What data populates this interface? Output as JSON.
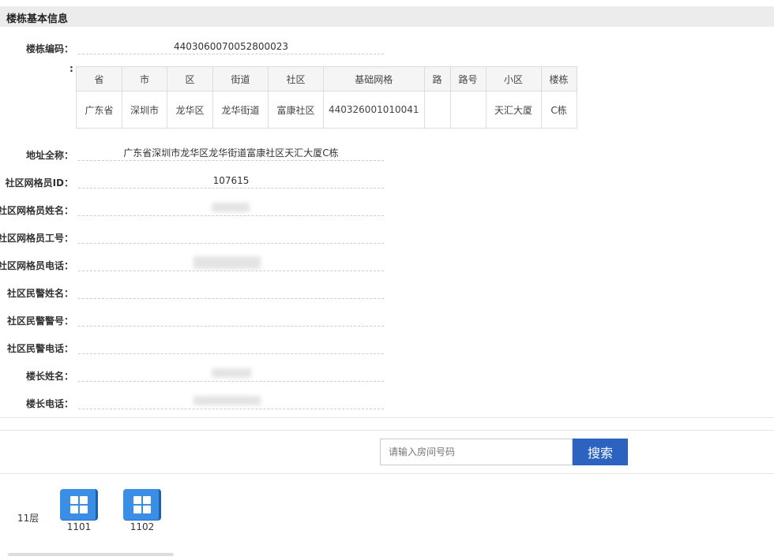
{
  "header": {
    "title": "楼栋基本信息"
  },
  "fields": {
    "building_code": {
      "label": "楼栋编码：",
      "value": "4403060070052800023"
    },
    "address_colon": ":",
    "address_full": {
      "label": "地址全称：",
      "value": "广东省深圳市龙华区龙华街道富康社区天汇大厦C栋"
    },
    "grid_member_id": {
      "label": "社区网格员ID：",
      "value": "107615"
    },
    "grid_member_name": {
      "label": "社区网格员姓名：",
      "value": ""
    },
    "grid_member_no": {
      "label": "社区网格员工号：",
      "value": ""
    },
    "grid_member_phone": {
      "label": "社区网格员电话：",
      "value": ""
    },
    "police_name": {
      "label": "社区民警姓名：",
      "value": ""
    },
    "police_no": {
      "label": "社区民警警号：",
      "value": ""
    },
    "police_phone": {
      "label": "社区民警电话：",
      "value": ""
    },
    "leader_name": {
      "label": "楼长姓名：",
      "value": ""
    },
    "leader_phone": {
      "label": "楼长电话：",
      "value": ""
    }
  },
  "address_table": {
    "headers": [
      "省",
      "市",
      "区",
      "街道",
      "社区",
      "基础网格",
      "路",
      "路号",
      "小区",
      "楼栋"
    ],
    "row": [
      "广东省",
      "深圳市",
      "龙华区",
      "龙华街道",
      "富康社区",
      "440326001010041",
      "",
      "",
      "天汇大厦",
      "C栋"
    ]
  },
  "search": {
    "placeholder": "请输入房间号码",
    "button_label": "搜索"
  },
  "floors": [
    {
      "label": "11层",
      "rooms": [
        "1101",
        "1102"
      ]
    }
  ],
  "colors": {
    "accent": "#2c63c0",
    "room_tile": "#3a8ee6",
    "header_bg": "#ececec"
  }
}
